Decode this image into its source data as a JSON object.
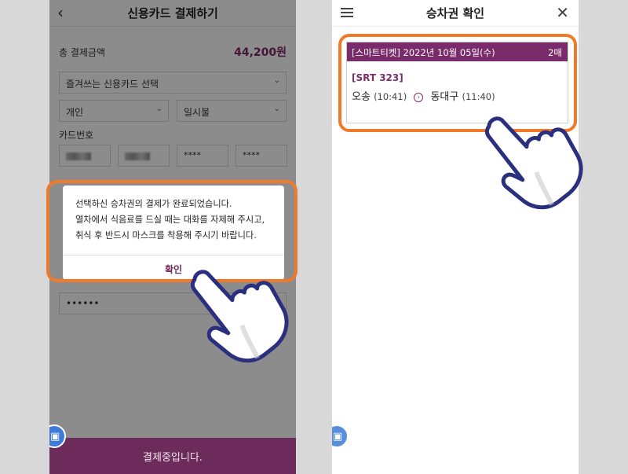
{
  "left": {
    "header": {
      "back_icon": "chevron-left-icon",
      "title": "신용카드 결제하기"
    },
    "total": {
      "label": "총 결제금액",
      "value": "44,200원"
    },
    "card_select": {
      "value": "즐겨쓰는 신용카드 선택"
    },
    "card_type": {
      "value": "개인"
    },
    "installment": {
      "value": "일시불"
    },
    "card_number": {
      "label": "카드번호",
      "part3": "****",
      "part4": "****"
    },
    "password_field": {
      "value": "••••••"
    },
    "dialog": {
      "line1": "선택하신 승차권의 결제가 완료되었습니다.",
      "line2": "열차에서 식음료를 드실 때는 대화를 자제해 주시고,",
      "line3": "취식 후 반드시 마스크를 착용해 주시기 바랍니다.",
      "ok_label": "확인"
    },
    "bottom_bar": {
      "label": "결제중입니다."
    }
  },
  "right": {
    "header": {
      "menu_icon": "hamburger-menu-icon",
      "title": "승차권 확인",
      "close_icon": "close-icon"
    },
    "ticket": {
      "header_text": "[스마트티켓] 2022년 10월 05일(수)",
      "count": "2매",
      "train": "[SRT 323]",
      "from_station": "오송",
      "from_time": "(10:41)",
      "to_station": "동대구",
      "to_time": "(11:40)"
    }
  },
  "colors": {
    "accent": "#7a2c6a",
    "highlight": "#f07a2a",
    "hand_outline": "#2a2f7e"
  }
}
